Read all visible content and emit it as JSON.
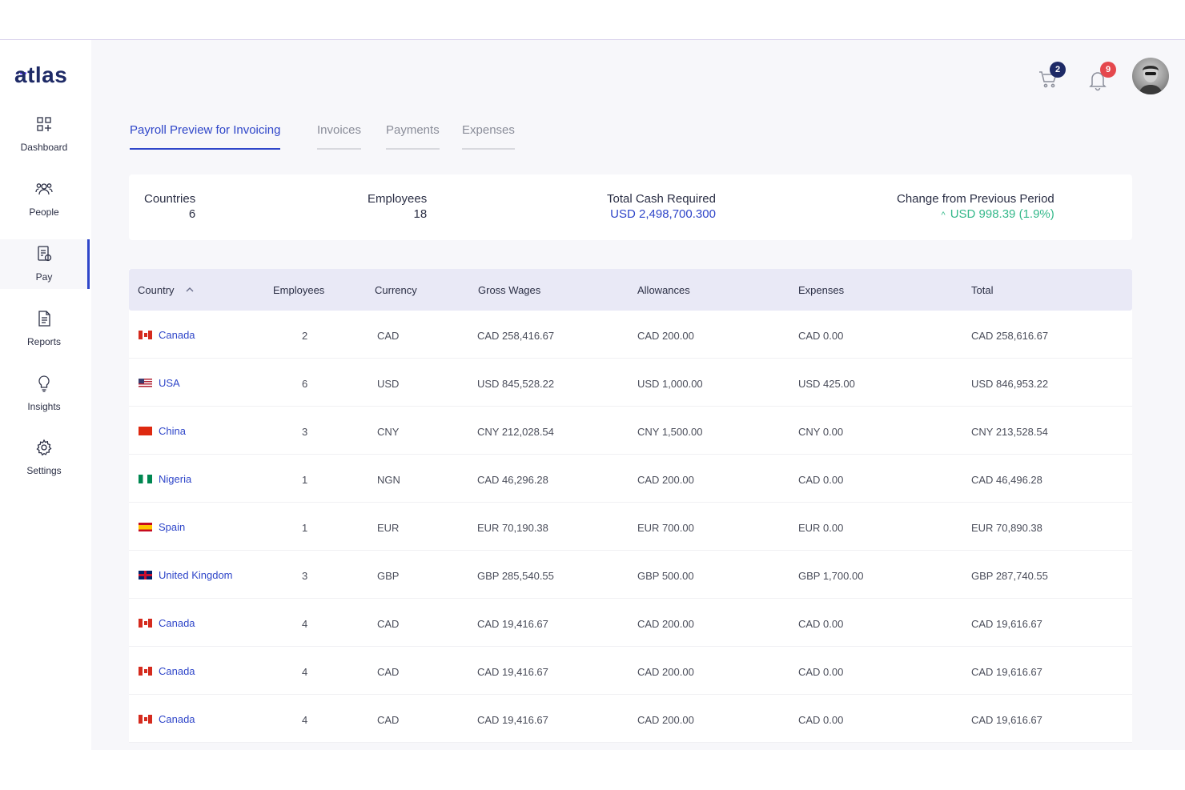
{
  "brand": {
    "name": "atlas"
  },
  "sidebar": {
    "items": [
      {
        "label": "Dashboard",
        "icon": "dashboard-icon"
      },
      {
        "label": "People",
        "icon": "people-icon"
      },
      {
        "label": "Pay",
        "icon": "pay-icon",
        "active": true
      },
      {
        "label": "Reports",
        "icon": "reports-icon"
      },
      {
        "label": "Insights",
        "icon": "insights-icon"
      },
      {
        "label": "Settings",
        "icon": "settings-icon"
      }
    ]
  },
  "header": {
    "cart_count": "2",
    "notification_count": "9",
    "cart_badge_color": "#1e2a66",
    "notification_badge_color": "#e5484d"
  },
  "tabs": [
    {
      "label": "Payroll Preview for Invoicing",
      "active": true
    },
    {
      "label": "Invoices"
    },
    {
      "label": "Payments"
    },
    {
      "label": "Expenses"
    }
  ],
  "summary": {
    "countries_label": "Countries",
    "countries_value": "6",
    "employees_label": "Employees",
    "employees_value": "18",
    "cash_label": "Total Cash Required",
    "cash_value": "USD 2,498,700.300",
    "change_label": "Change from Previous Period",
    "change_value": "USD 998.39 (1.9%)"
  },
  "table": {
    "headers": {
      "country": "Country",
      "employees": "Employees",
      "currency": "Currency",
      "gross": "Gross Wages",
      "allowances": "Allowances",
      "expenses": "Expenses",
      "total": "Total"
    },
    "rows": [
      {
        "flag": "ca",
        "country": "Canada",
        "employees": "2",
        "currency": "CAD",
        "gross": "CAD 258,416.67",
        "allowances": "CAD 200.00",
        "expenses": "CAD 0.00",
        "total": "CAD 258,616.67"
      },
      {
        "flag": "us",
        "country": "USA",
        "employees": "6",
        "currency": "USD",
        "gross": "USD 845,528.22",
        "allowances": "USD 1,000.00",
        "expenses": "USD 425.00",
        "total": "USD 846,953.22"
      },
      {
        "flag": "cn",
        "country": "China",
        "employees": "3",
        "currency": "CNY",
        "gross": "CNY 212,028.54",
        "allowances": "CNY 1,500.00",
        "expenses": "CNY 0.00",
        "total": "CNY 213,528.54"
      },
      {
        "flag": "ng",
        "country": "Nigeria",
        "employees": "1",
        "currency": "NGN",
        "gross": "CAD 46,296.28",
        "allowances": "CAD 200.00",
        "expenses": "CAD 0.00",
        "total": "CAD 46,496.28"
      },
      {
        "flag": "es",
        "country": "Spain",
        "employees": "1",
        "currency": "EUR",
        "gross": "EUR 70,190.38",
        "allowances": "EUR 700.00",
        "expenses": "EUR 0.00",
        "total": "EUR 70,890.38"
      },
      {
        "flag": "gb",
        "country": "United Kingdom",
        "employees": "3",
        "currency": "GBP",
        "gross": "GBP 285,540.55",
        "allowances": "GBP 500.00",
        "expenses": "GBP 1,700.00",
        "total": "GBP 287,740.55"
      },
      {
        "flag": "ca",
        "country": "Canada",
        "employees": "4",
        "currency": "CAD",
        "gross": "CAD 19,416.67",
        "allowances": "CAD 200.00",
        "expenses": "CAD 0.00",
        "total": "CAD 19,616.67"
      },
      {
        "flag": "ca",
        "country": "Canada",
        "employees": "4",
        "currency": "CAD",
        "gross": "CAD 19,416.67",
        "allowances": "CAD 200.00",
        "expenses": "CAD 0.00",
        "total": "CAD 19,616.67"
      },
      {
        "flag": "ca",
        "country": "Canada",
        "employees": "4",
        "currency": "CAD",
        "gross": "CAD 19,416.67",
        "allowances": "CAD 200.00",
        "expenses": "CAD 0.00",
        "total": "CAD 19,616.67"
      }
    ]
  }
}
